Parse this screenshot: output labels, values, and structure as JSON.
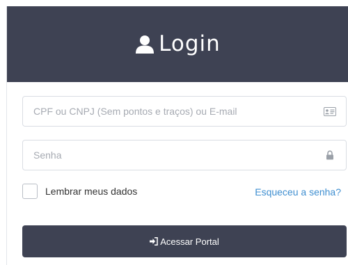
{
  "header": {
    "title": "Login",
    "icon": "user-icon"
  },
  "form": {
    "username": {
      "placeholder": "CPF ou CNPJ (Sem pontos e traços) ou E-mail",
      "value": "",
      "icon": "id-card-icon"
    },
    "password": {
      "placeholder": "Senha",
      "value": "",
      "icon": "lock-icon"
    },
    "remember_label": "Lembrar meus dados",
    "remember_checked": false,
    "forgot_link": "Esqueceu a senha?",
    "submit_label": "Acessar Portal",
    "submit_icon": "sign-in-icon"
  },
  "colors": {
    "header_bg": "#3e4253",
    "button_bg": "#3e4253",
    "link": "#3e8ed0"
  }
}
